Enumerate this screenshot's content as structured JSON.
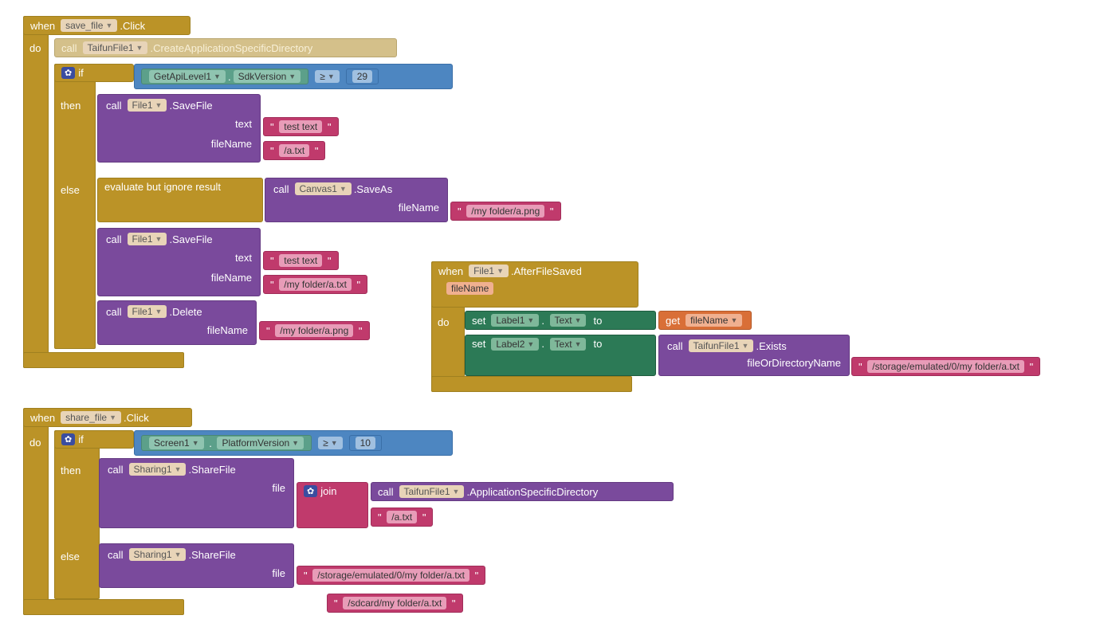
{
  "block1": {
    "when": "when",
    "component": "save_file",
    "event": ".Click",
    "do": "do",
    "call": "call",
    "taifun": "TaifunFile1",
    "createDir": ".CreateApplicationSpecificDirectory",
    "if": "if",
    "getapi_comp": "GetApiLevel1",
    "dot": " . ",
    "sdkversion": "SdkVersion",
    "gte": "≥",
    "twentynine": "29",
    "then": "then",
    "file1": "File1",
    "savefile": ".SaveFile",
    "text": "text",
    "test_text": "test text",
    "fileName_lbl": "fileName",
    "atxt": "/a.txt",
    "else": "else",
    "evalignore": "evaluate but ignore result",
    "canvas1": "Canvas1",
    "saveas": ".SaveAs",
    "myfolderpng": "/my folder/a.png",
    "myfoldertxt": "/my folder/a.txt",
    "delete": ".Delete"
  },
  "block2": {
    "when": "when",
    "file1": "File1",
    "afterfilesaved": ".AfterFileSaved",
    "fileName_param": "fileName",
    "do": "do",
    "set": "set",
    "label1": "Label1",
    "textprop": "Text",
    "to": "to",
    "get": "get",
    "fileName": "fileName",
    "label2": "Label2",
    "call": "call",
    "taifun": "TaifunFile1",
    "exists": ".Exists",
    "fileordir": "fileOrDirectoryName",
    "storagepath": "/storage/emulated/0/my folder/a.txt"
  },
  "block3": {
    "when": "when",
    "share_file": "share_file",
    "click": ".Click",
    "do": "do",
    "if": "if",
    "screen1": "Screen1",
    "platformversion": "PlatformVersion",
    "gte": "≥",
    "ten": "10",
    "then": "then",
    "call": "call",
    "sharing1": "Sharing1",
    "sharefile": ".ShareFile",
    "file": "file",
    "join": "join",
    "taifun": "TaifunFile1",
    "appspecdir": ".ApplicationSpecificDirectory",
    "atxt": "/a.txt",
    "else": "else",
    "storagepath": "/storage/emulated/0/my folder/a.txt",
    "sdcardpath": "/sdcard/my folder/a.txt"
  }
}
